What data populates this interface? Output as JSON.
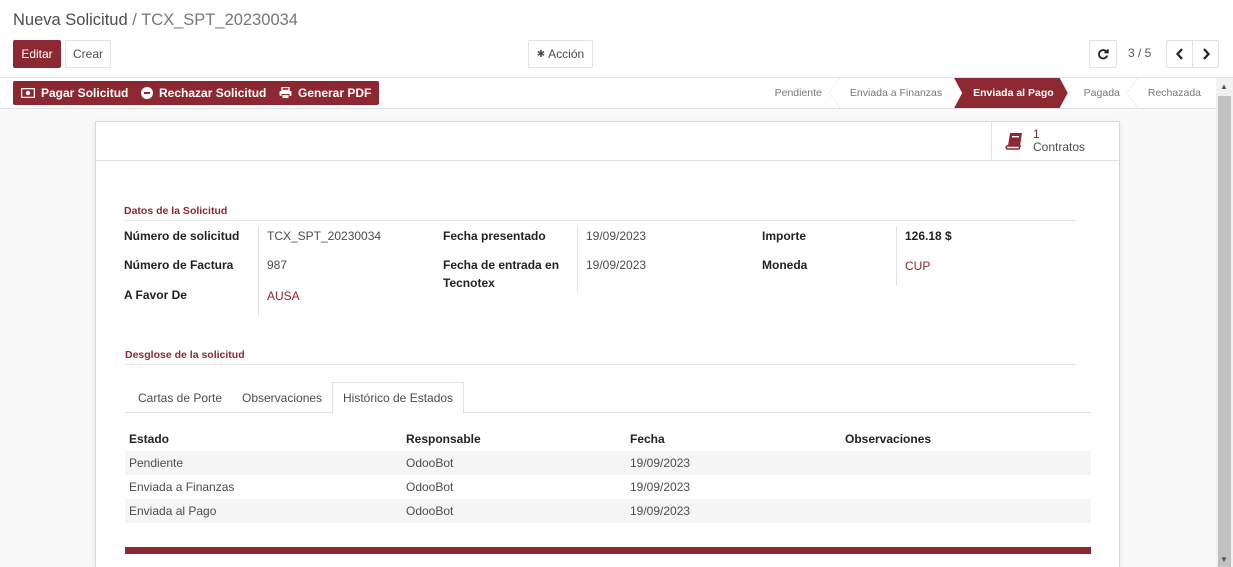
{
  "breadcrumb": {
    "parent": "Nueva Solicitud",
    "separator": " / ",
    "current": "TCX_SPT_20230034"
  },
  "toolbar": {
    "edit_label": "Editar",
    "create_label": "Crear",
    "action_label": "Acción"
  },
  "pager": {
    "value": "3 / 5"
  },
  "actions": {
    "pay_label": "Pagar Solicitud",
    "reject_label": "Rechazar Solicitud",
    "pdf_label": "Generar PDF"
  },
  "stages": [
    "Pendiente",
    "Enviada a Finanzas",
    "Enviada al Pago",
    "Pagada",
    "Rechazada"
  ],
  "active_stage": "Enviada al Pago",
  "smart_button": {
    "count": "1",
    "label": "Contratos"
  },
  "section1": {
    "title": "Datos de la Solicitud",
    "numero_label": "Número de solicitud",
    "numero_value": "TCX_SPT_20230034",
    "factura_label": "Número de Factura",
    "factura_value": "987",
    "favor_label": "A Favor De",
    "favor_value": "AUSA",
    "presentado_label": "Fecha presentado",
    "presentado_value": "19/09/2023",
    "entrada_label_1": "Fecha de entrada en",
    "entrada_label_2": "Tecnotex",
    "entrada_value": "19/09/2023",
    "importe_label": "Importe",
    "importe_value": "126.18 $",
    "moneda_label": "Moneda",
    "moneda_value": "CUP"
  },
  "section2": {
    "title": "Desglose de la solicitud"
  },
  "tabs": [
    "Cartas de Porte",
    "Observaciones",
    "Histórico de Estados"
  ],
  "history": {
    "headers": [
      "Estado",
      "Responsable",
      "Fecha",
      "Observaciones"
    ],
    "rows": [
      [
        "Pendiente",
        "OdooBot",
        "19/09/2023",
        ""
      ],
      [
        "Enviada a Finanzas",
        "OdooBot",
        "19/09/2023",
        ""
      ],
      [
        "Enviada al Pago",
        "OdooBot",
        "19/09/2023",
        ""
      ]
    ]
  },
  "colors": {
    "brand": "#8c2831"
  }
}
